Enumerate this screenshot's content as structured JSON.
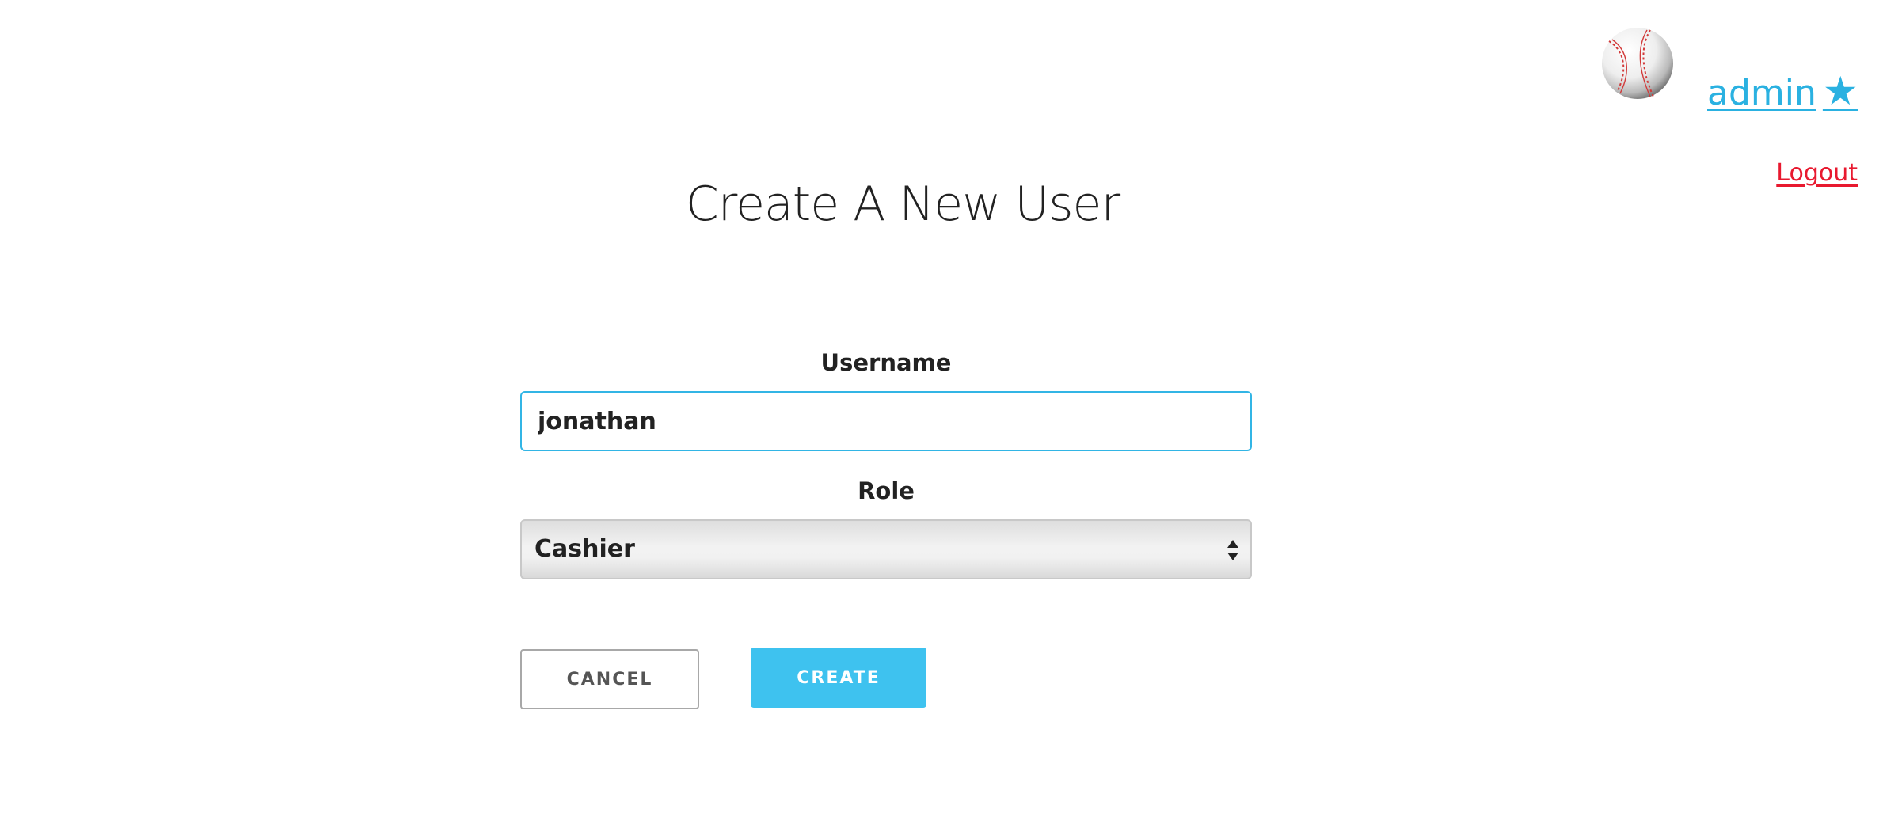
{
  "header": {
    "avatar_icon": "baseball-icon",
    "username": "admin",
    "user_star": "★",
    "logout_label": "Logout",
    "link_color": "#2ab1e1",
    "logout_color": "#e8192f"
  },
  "main": {
    "title": "Create A New User"
  },
  "form": {
    "username_label": "Username",
    "username_value": "jonathan",
    "role_label": "Role",
    "role_value": "Cashier",
    "role_arrows_icon": "select-updown-icon",
    "cancel_label": "CANCEL",
    "create_label": "CREATE",
    "accent_color": "#3ec2ef"
  }
}
